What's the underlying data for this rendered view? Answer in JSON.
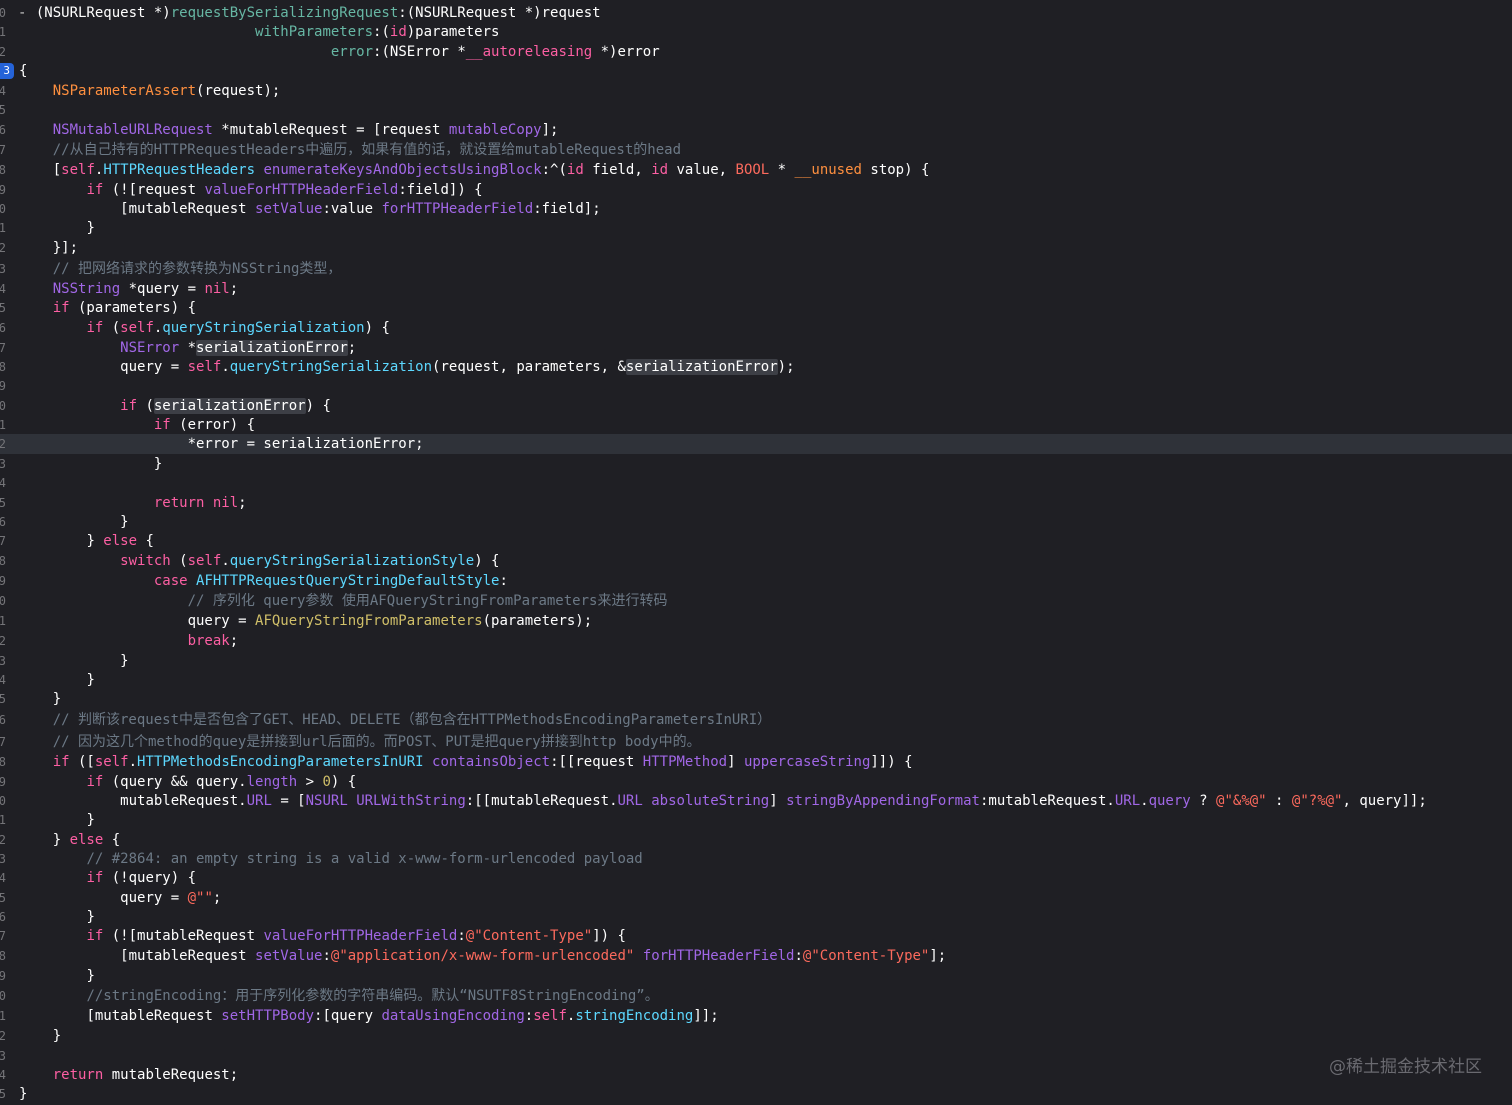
{
  "editor": {
    "current_line_number": "2",
    "breakpoint_label": "3",
    "watermark": "@稀土掘金技术社区",
    "lines": [
      {
        "gutter": "0",
        "tokens": [
          [
            "(NSURLRequest *)",
            "pl"
          ],
          [
            "requestBySerializingRequest",
            "fn"
          ],
          [
            ":(NSURLRequest *)request",
            "pl"
          ]
        ],
        "indent": "  "
      },
      {
        "gutter": "1",
        "tokens": [
          [
            "withParameters",
            "fn"
          ],
          [
            ":(",
            "pl"
          ],
          [
            "id",
            "kw"
          ],
          [
            ")parameters",
            "pl"
          ]
        ],
        "indent": "                            "
      },
      {
        "gutter": "2",
        "tokens": [
          [
            "error",
            "fn"
          ],
          [
            ":(NSError *",
            "pl"
          ],
          [
            "__autoreleasing",
            "kw"
          ],
          [
            " *)error",
            "pl"
          ]
        ],
        "indent": "                                     "
      },
      {
        "gutter": "3",
        "tokens": [
          [
            "{",
            "pl"
          ]
        ],
        "indent": ""
      },
      {
        "gutter": "4",
        "tokens": [
          [
            "NSParameterAssert",
            "mc"
          ],
          [
            "(request);",
            "pl"
          ]
        ],
        "indent": "    "
      },
      {
        "gutter": "5",
        "tokens": [],
        "indent": ""
      },
      {
        "gutter": "6",
        "tokens": [
          [
            "NSMutableURLRequest",
            "ty"
          ],
          [
            " *mutableRequest = [request ",
            "pl"
          ],
          [
            "mutableCopy",
            "ty"
          ],
          [
            "];",
            "pl"
          ]
        ],
        "indent": "    "
      },
      {
        "gutter": "7",
        "tokens": [
          [
            "//从自己持有的HTTPRequestHeaders中遍历，如果有值的话，就设置给mutableRequest的head",
            "cm"
          ]
        ],
        "indent": "    "
      },
      {
        "gutter": "8",
        "tokens": [
          [
            "[",
            "pl"
          ],
          [
            "self",
            "kw"
          ],
          [
            ".",
            "pl"
          ],
          [
            "HTTPRequestHeaders",
            "cl"
          ],
          [
            " ",
            "pl"
          ],
          [
            "enumerateKeysAndObjectsUsingBlock",
            "ty"
          ],
          [
            ":^(",
            "pl"
          ],
          [
            "id",
            "kw"
          ],
          [
            " field, ",
            "pl"
          ],
          [
            "id",
            "kw"
          ],
          [
            " value, ",
            "pl"
          ],
          [
            "BOOL",
            "st"
          ],
          [
            " * ",
            "pl"
          ],
          [
            "__unused",
            "mc"
          ],
          [
            " stop) {",
            "pl"
          ]
        ],
        "indent": "    "
      },
      {
        "gutter": "9",
        "tokens": [
          [
            "if",
            "kw"
          ],
          [
            " (![request ",
            "pl"
          ],
          [
            "valueForHTTPHeaderField",
            "ty"
          ],
          [
            ":field]) {",
            "pl"
          ]
        ],
        "indent": "        "
      },
      {
        "gutter": "0",
        "tokens": [
          [
            "[mutableRequest ",
            "pl"
          ],
          [
            "setValue",
            "ty"
          ],
          [
            ":value ",
            "pl"
          ],
          [
            "forHTTPHeaderField",
            "ty"
          ],
          [
            ":field];",
            "pl"
          ]
        ],
        "indent": "            "
      },
      {
        "gutter": "1",
        "tokens": [
          [
            "}",
            "pl"
          ]
        ],
        "indent": "        "
      },
      {
        "gutter": "2",
        "tokens": [
          [
            "}];",
            "pl"
          ]
        ],
        "indent": "    "
      },
      {
        "gutter": "3",
        "tokens": [
          [
            "// 把网络请求的参数转换为NSString类型，",
            "cm"
          ]
        ],
        "indent": "    "
      },
      {
        "gutter": "4",
        "tokens": [
          [
            "NSString",
            "ty"
          ],
          [
            " *query = ",
            "pl"
          ],
          [
            "nil",
            "kw"
          ],
          [
            ";",
            "pl"
          ]
        ],
        "indent": "    "
      },
      {
        "gutter": "5",
        "tokens": [
          [
            "if",
            "kw"
          ],
          [
            " (parameters) {",
            "pl"
          ]
        ],
        "indent": "    "
      },
      {
        "gutter": "6",
        "tokens": [
          [
            "if",
            "kw"
          ],
          [
            " (",
            "pl"
          ],
          [
            "self",
            "kw"
          ],
          [
            ".",
            "pl"
          ],
          [
            "queryStringSerialization",
            "cl"
          ],
          [
            ") {",
            "pl"
          ]
        ],
        "indent": "        "
      },
      {
        "gutter": "7",
        "tokens": [
          [
            "NSError",
            "ty"
          ],
          [
            " *",
            "pl"
          ],
          [
            "serializationError",
            "hl"
          ],
          [
            ";",
            "pl"
          ]
        ],
        "indent": "            "
      },
      {
        "gutter": "8",
        "tokens": [
          [
            "query = ",
            "pl"
          ],
          [
            "self",
            "kw"
          ],
          [
            ".",
            "pl"
          ],
          [
            "queryStringSerialization",
            "cl"
          ],
          [
            "(request, parameters, &",
            "pl"
          ],
          [
            "serializationError",
            "hl"
          ],
          [
            ");",
            "pl"
          ]
        ],
        "indent": "            "
      },
      {
        "gutter": "9",
        "tokens": [],
        "indent": ""
      },
      {
        "gutter": "0",
        "tokens": [
          [
            "if",
            "kw"
          ],
          [
            " (",
            "pl"
          ],
          [
            "serializationError",
            "hl"
          ],
          [
            ") {",
            "pl"
          ]
        ],
        "indent": "            "
      },
      {
        "gutter": "1",
        "tokens": [
          [
            "if",
            "kw"
          ],
          [
            " (error) {",
            "pl"
          ]
        ],
        "indent": "                "
      },
      {
        "gutter": "2",
        "tokens": [
          [
            "*error = serializationError;",
            "pl"
          ]
        ],
        "indent": "                    "
      },
      {
        "gutter": "3",
        "tokens": [
          [
            "}",
            "pl"
          ]
        ],
        "indent": "                "
      },
      {
        "gutter": "4",
        "tokens": [],
        "indent": ""
      },
      {
        "gutter": "5",
        "tokens": [
          [
            "return",
            "kw"
          ],
          [
            " ",
            "pl"
          ],
          [
            "nil",
            "kw"
          ],
          [
            ";",
            "pl"
          ]
        ],
        "indent": "                "
      },
      {
        "gutter": "6",
        "tokens": [
          [
            "}",
            "pl"
          ]
        ],
        "indent": "            "
      },
      {
        "gutter": "7",
        "tokens": [
          [
            "} ",
            "pl"
          ],
          [
            "else",
            "kw"
          ],
          [
            " {",
            "pl"
          ]
        ],
        "indent": "        "
      },
      {
        "gutter": "8",
        "tokens": [
          [
            "switch",
            "kw"
          ],
          [
            " (",
            "pl"
          ],
          [
            "self",
            "kw"
          ],
          [
            ".",
            "pl"
          ],
          [
            "queryStringSerializationStyle",
            "cl"
          ],
          [
            ") {",
            "pl"
          ]
        ],
        "indent": "            "
      },
      {
        "gutter": "9",
        "tokens": [
          [
            "case",
            "kw"
          ],
          [
            " ",
            "pl"
          ],
          [
            "AFHTTPRequestQueryStringDefaultStyle",
            "cl"
          ],
          [
            ":",
            "pl"
          ]
        ],
        "indent": "                "
      },
      {
        "gutter": "0",
        "tokens": [
          [
            "// 序列化 query参数 使用AFQueryStringFromParameters来进行转码",
            "cm"
          ]
        ],
        "indent": "                    "
      },
      {
        "gutter": "1",
        "tokens": [
          [
            "query = ",
            "pl"
          ],
          [
            "AFQueryStringFromParameters",
            "nm"
          ],
          [
            "(parameters);",
            "pl"
          ]
        ],
        "indent": "                    "
      },
      {
        "gutter": "2",
        "tokens": [
          [
            "break",
            "kw"
          ],
          [
            ";",
            "pl"
          ]
        ],
        "indent": "                    "
      },
      {
        "gutter": "3",
        "tokens": [
          [
            "}",
            "pl"
          ]
        ],
        "indent": "            "
      },
      {
        "gutter": "4",
        "tokens": [
          [
            "}",
            "pl"
          ]
        ],
        "indent": "        "
      },
      {
        "gutter": "5",
        "tokens": [
          [
            "}",
            "pl"
          ]
        ],
        "indent": "    "
      },
      {
        "gutter": "6",
        "tokens": [
          [
            "// 判断该request中是否包含了GET、HEAD、DELETE（都包含在HTTPMethodsEncodingParametersInURI）",
            "cm"
          ]
        ],
        "indent": "    "
      },
      {
        "gutter": "7",
        "tokens": [
          [
            "// 因为这几个method的quey是拼接到url后面的。而POST、PUT是把query拼接到http body中的。",
            "cm"
          ]
        ],
        "indent": "    "
      },
      {
        "gutter": "8",
        "tokens": [
          [
            "if",
            "kw"
          ],
          [
            " ([",
            "pl"
          ],
          [
            "self",
            "kw"
          ],
          [
            ".",
            "pl"
          ],
          [
            "HTTPMethodsEncodingParametersInURI",
            "cl"
          ],
          [
            " ",
            "pl"
          ],
          [
            "containsObject",
            "ty"
          ],
          [
            ":[[request ",
            "pl"
          ],
          [
            "HTTPMethod",
            "ty"
          ],
          [
            "] ",
            "pl"
          ],
          [
            "uppercaseString",
            "ty"
          ],
          [
            "]]) {",
            "pl"
          ]
        ],
        "indent": "    "
      },
      {
        "gutter": "9",
        "tokens": [
          [
            "if",
            "kw"
          ],
          [
            " (query && query.",
            "pl"
          ],
          [
            "length",
            "ty"
          ],
          [
            " > ",
            "pl"
          ],
          [
            "0",
            "nm"
          ],
          [
            ") {",
            "pl"
          ]
        ],
        "indent": "        "
      },
      {
        "gutter": "0",
        "tokens": [
          [
            "mutableRequest.",
            "pl"
          ],
          [
            "URL",
            "ty"
          ],
          [
            " = [",
            "pl"
          ],
          [
            "NSURL",
            "ty"
          ],
          [
            " ",
            "pl"
          ],
          [
            "URLWithString",
            "ty"
          ],
          [
            ":[[mutableRequest.",
            "pl"
          ],
          [
            "URL",
            "ty"
          ],
          [
            " ",
            "pl"
          ],
          [
            "absoluteString",
            "ty"
          ],
          [
            "] ",
            "pl"
          ],
          [
            "stringByAppendingFormat",
            "ty"
          ],
          [
            ":mutableRequest.",
            "pl"
          ],
          [
            "URL",
            "ty"
          ],
          [
            ".",
            "pl"
          ],
          [
            "query",
            "ty"
          ],
          [
            " ? ",
            "pl"
          ],
          [
            "@\"&%@\"",
            "st"
          ],
          [
            " : ",
            "pl"
          ],
          [
            "@\"?%@\"",
            "st"
          ],
          [
            ", query]];",
            "pl"
          ]
        ],
        "indent": "            "
      },
      {
        "gutter": "1",
        "tokens": [
          [
            "}",
            "pl"
          ]
        ],
        "indent": "        "
      },
      {
        "gutter": "2",
        "tokens": [
          [
            "} ",
            "pl"
          ],
          [
            "else",
            "kw"
          ],
          [
            " {",
            "pl"
          ]
        ],
        "indent": "    "
      },
      {
        "gutter": "3",
        "tokens": [
          [
            "// #2864: an empty string is a valid x-www-form-urlencoded payload",
            "cm"
          ]
        ],
        "indent": "        "
      },
      {
        "gutter": "4",
        "tokens": [
          [
            "if",
            "kw"
          ],
          [
            " (!query) {",
            "pl"
          ]
        ],
        "indent": "        "
      },
      {
        "gutter": "5",
        "tokens": [
          [
            "query = ",
            "pl"
          ],
          [
            "@\"\"",
            "st"
          ],
          [
            ";",
            "pl"
          ]
        ],
        "indent": "            "
      },
      {
        "gutter": "6",
        "tokens": [
          [
            "}",
            "pl"
          ]
        ],
        "indent": "        "
      },
      {
        "gutter": "7",
        "tokens": [
          [
            "if",
            "kw"
          ],
          [
            " (![mutableRequest ",
            "pl"
          ],
          [
            "valueForHTTPHeaderField",
            "ty"
          ],
          [
            ":",
            "pl"
          ],
          [
            "@\"Content-Type\"",
            "st"
          ],
          [
            "]) {",
            "pl"
          ]
        ],
        "indent": "        "
      },
      {
        "gutter": "8",
        "tokens": [
          [
            "[mutableRequest ",
            "pl"
          ],
          [
            "setValue",
            "ty"
          ],
          [
            ":",
            "pl"
          ],
          [
            "@\"application/x-www-form-urlencoded\"",
            "st"
          ],
          [
            " ",
            "pl"
          ],
          [
            "forHTTPHeaderField",
            "ty"
          ],
          [
            ":",
            "pl"
          ],
          [
            "@\"Content-Type\"",
            "st"
          ],
          [
            "];",
            "pl"
          ]
        ],
        "indent": "            "
      },
      {
        "gutter": "9",
        "tokens": [
          [
            "}",
            "pl"
          ]
        ],
        "indent": "        "
      },
      {
        "gutter": "0",
        "tokens": [
          [
            "//stringEncoding：用于序列化参数的字符串编码。默认“NSUTF8StringEncoding”。",
            "cm"
          ]
        ],
        "indent": "        "
      },
      {
        "gutter": "1",
        "tokens": [
          [
            "[mutableRequest ",
            "pl"
          ],
          [
            "setHTTPBody",
            "ty"
          ],
          [
            ":[query ",
            "pl"
          ],
          [
            "dataUsingEncoding",
            "ty"
          ],
          [
            ":",
            "pl"
          ],
          [
            "self",
            "kw"
          ],
          [
            ".",
            "pl"
          ],
          [
            "stringEncoding",
            "cl"
          ],
          [
            "]];",
            "pl"
          ]
        ],
        "indent": "        "
      },
      {
        "gutter": "2",
        "tokens": [
          [
            "}",
            "pl"
          ]
        ],
        "indent": "    "
      },
      {
        "gutter": "3",
        "tokens": [],
        "indent": ""
      },
      {
        "gutter": "4",
        "tokens": [
          [
            "return",
            "kw"
          ],
          [
            " mutableRequest;",
            "pl"
          ]
        ],
        "indent": "    "
      },
      {
        "gutter": "5",
        "tokens": [
          [
            "}",
            "pl"
          ]
        ],
        "indent": ""
      }
    ]
  }
}
